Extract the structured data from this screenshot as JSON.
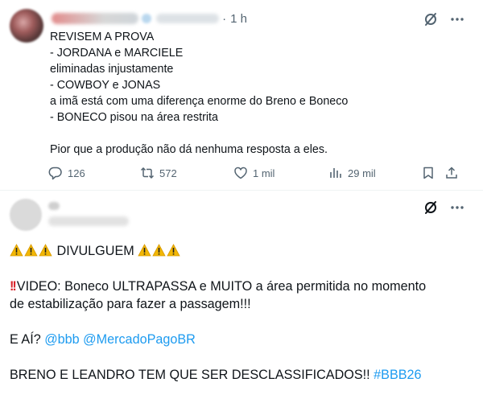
{
  "tweet1": {
    "time": "1 h",
    "lines": [
      "REVISEM A PROVA",
      "- JORDANA e MARCIELE",
      "eliminadas injustamente",
      "- COWBOY e JONAS",
      "a imã está com uma diferença enorme do Breno e Boneco",
      "- BONECO pisou na área restrita",
      "",
      "Pior que a produção não dá nenhuma resposta a eles."
    ],
    "stats": {
      "replies": "126",
      "reposts": "572",
      "likes": "1 mil",
      "views": "29 mil"
    }
  },
  "tweet2": {
    "divulguem": "DIVULGUEM",
    "video_line1": "VIDEO: Boneco ULTRAPASSA e MUITO a área permitida no momento",
    "video_line2": "de estabilização para fazer a passagem!!!",
    "eai": "E AÍ?",
    "mention1": "@bbb",
    "mention2": "@MercadoPagoBR",
    "breno": "BRENO E LEANDRO TEM QUE SER DESCLASSIFICADOS!!",
    "hashtag": "#BBB26"
  },
  "colors": {
    "text": "#0f1419",
    "muted": "#536471",
    "link": "#1d9bf0",
    "warning_fill": "#f2b705",
    "alert_red": "#d8232a"
  },
  "icons": [
    "grok-icon",
    "more-icon",
    "reply-icon",
    "repost-icon",
    "like-icon",
    "views-icon",
    "bookmark-icon",
    "share-icon",
    "warning-icon",
    "double-exclamation-icon"
  ]
}
